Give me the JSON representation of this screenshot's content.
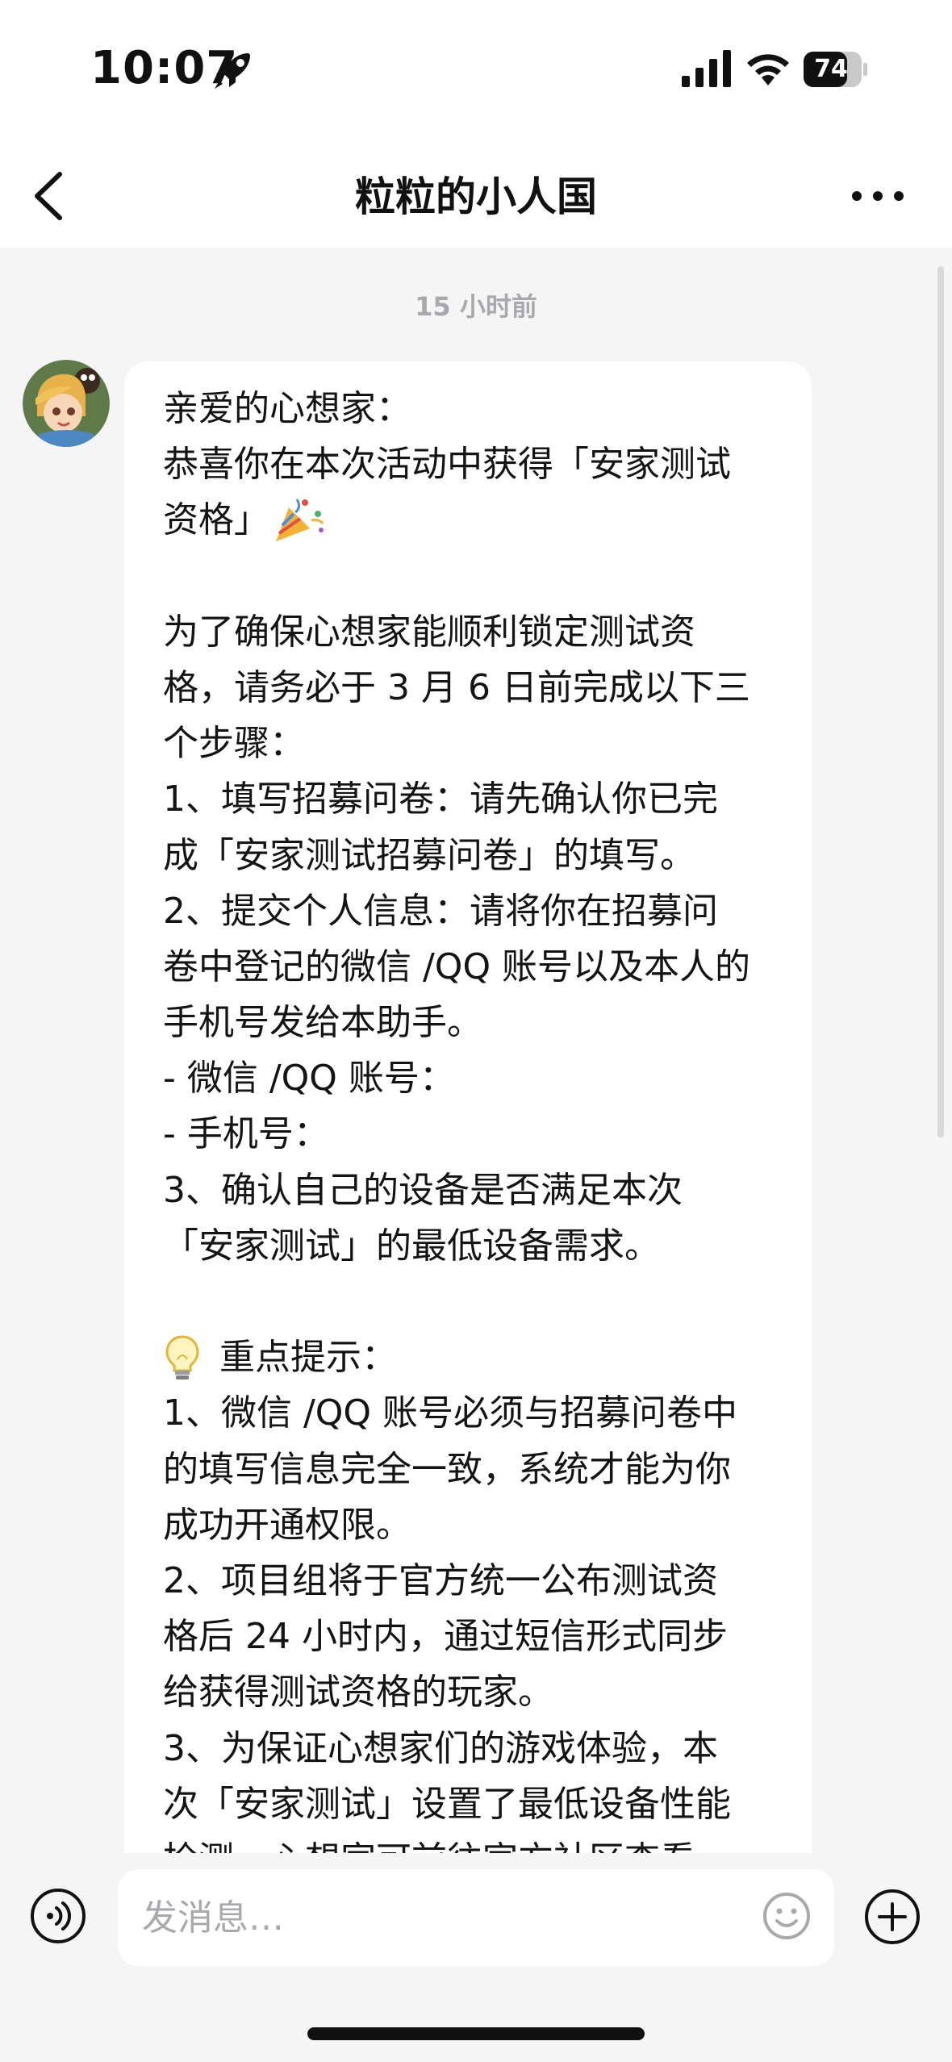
{
  "status_bar": {
    "time": "10:07",
    "battery": "74",
    "icons": [
      "rocket-icon",
      "signal-icon",
      "wifi-icon",
      "battery-icon"
    ]
  },
  "nav": {
    "title": "粒粒的小人国",
    "back_icon": "chevron-left-icon",
    "more_icon": "more-horizontal-icon"
  },
  "chat": {
    "timestamp": "15 小时前",
    "message": {
      "lines": [
        "亲爱的心想家：",
        "恭喜你在本次活动中获得「安家测试",
        "资格」",
        "",
        "为了确保心想家能顺利锁定测试资",
        "格，请务必于 3 月 6 日前完成以下三",
        "个步骤：",
        "1、填写招募问卷：请先确认你已完",
        "成「安家测试招募问卷」的填写。",
        "2、提交个人信息：请将你在招募问",
        "卷中登记的微信 /QQ 账号以及本人的",
        "手机号发给本助手。",
        "- 微信 /QQ 账号：",
        "- 手机号：",
        "3、确认自己的设备是否满足本次",
        "「安家测试」的最低设备需求。",
        "",
        "重点提示：",
        "1、微信 /QQ 账号必须与招募问卷中",
        "的填写信息完全一致，系统才能为你",
        "成功开通权限。",
        "2、项目组将于官方统一公布测试资",
        "格后 24 小时内，通过短信形式同步",
        "给获得测试资格的玩家。",
        "3、为保证心想家们的游戏体验，本",
        "次「安家测试」设置了最低设备性能",
        "检测，心想家可前往官方社区查看"
      ]
    }
  },
  "input_bar": {
    "placeholder": "发消息…",
    "icons": [
      "voice-icon",
      "emoji-icon",
      "plus-icon"
    ]
  },
  "colors": {
    "background": "#f5f5f6",
    "bubble": "#ffffff",
    "muted_text": "#a8a8ad"
  }
}
